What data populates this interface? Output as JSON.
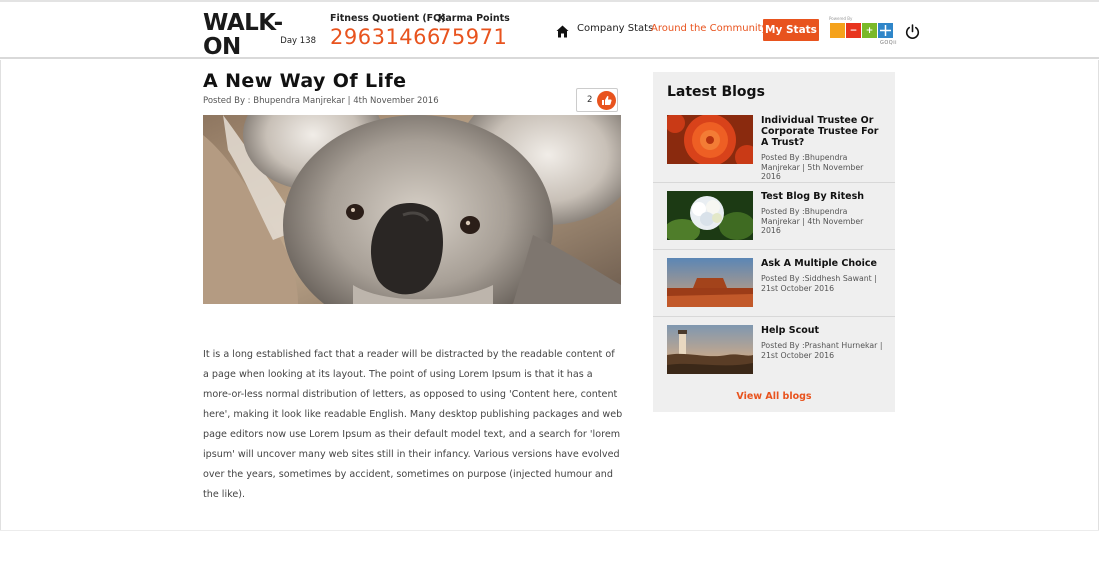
{
  "header": {
    "logo_text": "WALK-ON",
    "day_label": "Day 138",
    "fq_label": "Fitness Quotient (FQ)",
    "fq_value": "29631466",
    "karma_label": "Karma Points",
    "karma_value": "75971",
    "nav": {
      "home_icon": "home-icon",
      "company_stats": "Company Stats",
      "around_community": "Around the Community",
      "my_stats": "My Stats"
    },
    "powered_label": "Powered By",
    "gooh_word": "GOQii",
    "power_icon": "power-icon"
  },
  "post": {
    "title": "A New Way Of Life",
    "meta": "Posted By : Bhupendra Manjrekar | 4th November 2016",
    "likes": "2",
    "like_icon": "thumbs-up-icon",
    "image": "koala-photo",
    "body": "It is a long established fact that a reader will be distracted by the readable content of a page when looking at its layout. The point of using Lorem Ipsum is that it has a more-or-less normal distribution of letters, as opposed to using 'Content here, content here', making it look like readable English. Many desktop publishing packages and web page editors now use Lorem Ipsum as their default model text, and a search for 'lorem ipsum' will uncover many web sites still in their infancy. Various versions have evolved over the years, sometimes by accident, sometimes on purpose (injected humour and the like)."
  },
  "sidebar": {
    "title": "Latest Blogs",
    "blogs": [
      {
        "title": "Individual Trustee Or Corporate Trustee For A Trust?",
        "meta": "Posted By :Bhupendra Manjrekar | 5th November 2016",
        "thumb": "red-flower-photo"
      },
      {
        "title": "Test Blog By Ritesh",
        "meta": "Posted By :Bhupendra Manjrekar | 4th November 2016",
        "thumb": "white-hydrangea-photo"
      },
      {
        "title": "Ask A Multiple Choice",
        "meta": "Posted By :Siddhesh Sawant | 21st October 2016",
        "thumb": "desert-mesa-photo"
      },
      {
        "title": "Help Scout",
        "meta": "Posted By :Prashant Hurnekar | 21st October 2016",
        "thumb": "lighthouse-photo"
      }
    ],
    "view_all": "View All blogs"
  },
  "colors": {
    "accent": "#e8531e",
    "sidebar_bg": "#efefef"
  }
}
